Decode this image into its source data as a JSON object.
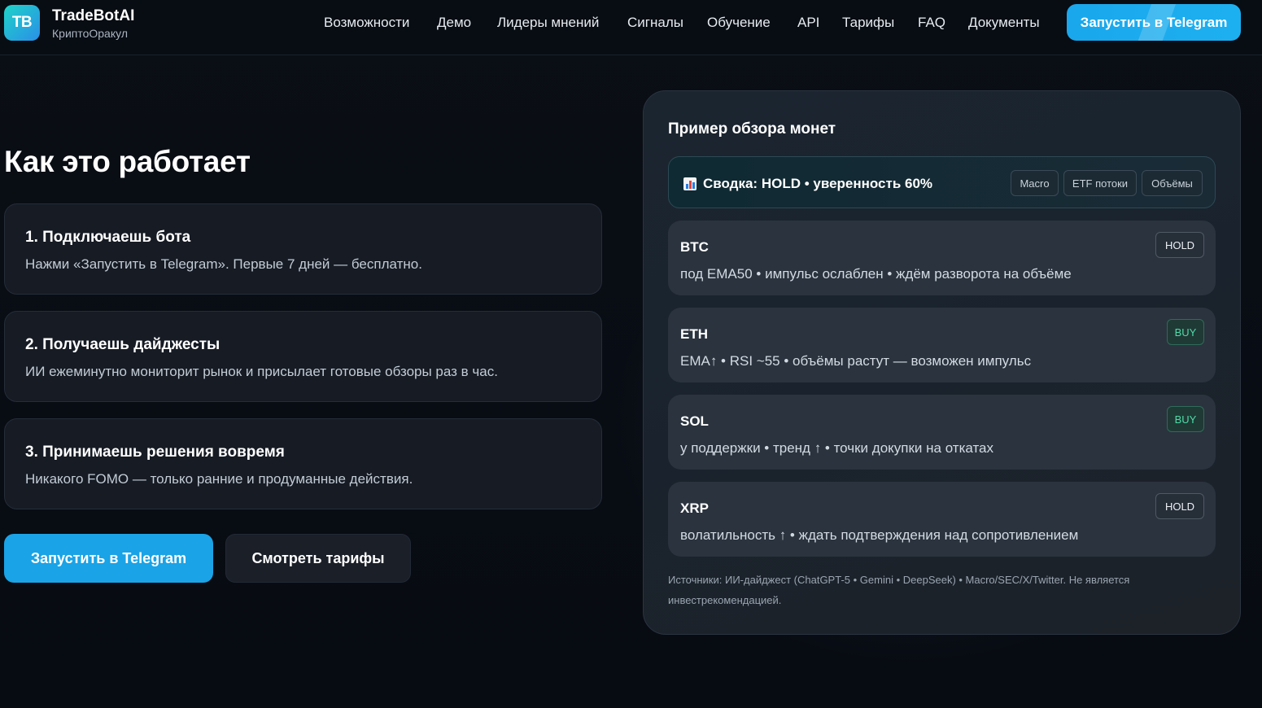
{
  "header": {
    "logo_text": "TB",
    "brand_name": "TradeBotAI",
    "brand_sub": "КриптоОракул",
    "nav": [
      "Возможности",
      "Демо",
      "Лидеры мнений",
      "Сигналы",
      "Обучение",
      "API",
      "Тарифы",
      "FAQ",
      "Документы"
    ],
    "cta_label": "Запустить в Telegram"
  },
  "how": {
    "title": "Как это работает",
    "steps": [
      {
        "title": "1. Подключаешь бота",
        "desc": "Нажми «Запустить в Telegram». Первые 7 дней — бесплатно."
      },
      {
        "title": "2. Получаешь дайджесты",
        "desc": "ИИ ежеминутно мониторит рынок и присылает готовые обзоры раз в час."
      },
      {
        "title": "3. Принимаешь решения вовремя",
        "desc": "Никакого FOMO — только ранние и продуманные действия."
      }
    ],
    "primary_button": "Запустить в Telegram",
    "secondary_button": "Смотреть тарифы"
  },
  "panel": {
    "title": "Пример обзора монет",
    "summary": {
      "label": "Сводка:",
      "text": "HOLD • уверенность 60%",
      "tags": [
        "Macro",
        "ETF потоки",
        "Объёмы"
      ]
    },
    "coins": [
      {
        "name": "BTC",
        "desc": "под EMA50 • импульс ослаблен • ждём разворота на объёме",
        "signal": "HOLD"
      },
      {
        "name": "ETH",
        "desc": "EMA↑ • RSI ~55 • объёмы растут — возможен импульс",
        "signal": "BUY"
      },
      {
        "name": "SOL",
        "desc": "у поддержки • тренд ↑ • точки докупки на откатах",
        "signal": "BUY"
      },
      {
        "name": "XRP",
        "desc": "волатильность ↑ • ждать подтверждения над сопротивлением",
        "signal": "HOLD"
      }
    ],
    "disclaimer": "Источники: ИИ-дайджест (ChatGPT-5 • Gemini • DeepSeek) • Macro/SEC/X/Twitter. Не является инвестрекомендацией."
  },
  "colors": {
    "accent": "#1aa3e6",
    "buy": "#4fdba8",
    "background": "#070b12"
  }
}
